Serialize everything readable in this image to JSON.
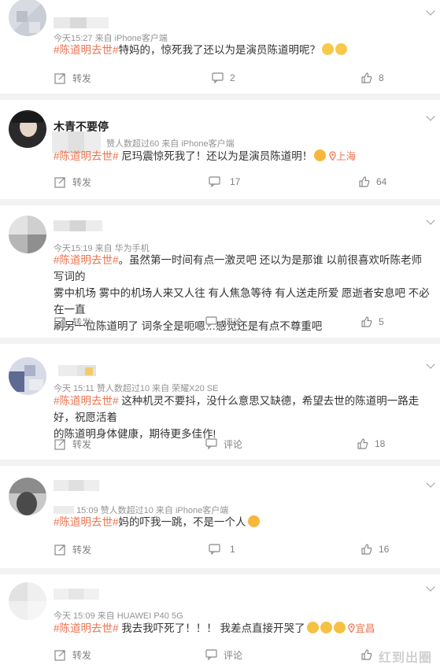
{
  "actions": {
    "repost": "转发",
    "comment": "评论"
  },
  "colors": {
    "accent": "#eb7350",
    "meta": "#939393"
  },
  "posts": [
    {
      "meta": "今天15:27 来自 iPhone客户端",
      "hashtag": "#陈道明去世#",
      "text": "特妈的，惊死我了还以为是演员陈道明呢？",
      "emojis": [
        "wow-emoji",
        "wow-emoji"
      ],
      "comment_count": "2",
      "like_count": "8"
    },
    {
      "username": "木青不要停",
      "meta": "赞人数超过60 来自 iPhone客户端",
      "hashtag": "#陈道明去世#",
      "text": " 尼玛震惊死我了！还以为是演员陈道明！",
      "emojis": [
        "laugh-cry-emoji"
      ],
      "location": "上海",
      "comment_count": "17",
      "like_count": "64"
    },
    {
      "meta": "今天15:19 来自 华为手机",
      "hashtag": "#陈道明去世#",
      "text_lines": [
        "。虽然第一时间有点一激灵吧 还以为是那谁 以前很喜欢听陈老师写词的",
        "雾中机场 雾中的机场人来又人往 有人焦急等待 有人送走所爱 愿逝者安息吧 不必在一直",
        "刷另一位陈道明了 词条全是呃嗯…感觉还是有点不尊重吧"
      ],
      "like_count": "5"
    },
    {
      "meta": "今天 15:11 赞人数超过10  来自 荣耀X20 SE",
      "hashtag": "#陈道明去世#",
      "text_lines": [
        " 这种机灵不要抖，没什么意思又缺德，希望去世的陈道明一路走好，祝愿活着",
        "的陈道明身体健康，期待更多佳作!"
      ],
      "like_count": "18"
    },
    {
      "meta": "15:09 赞人数超过10  来自 iPhone客户端",
      "hashtag": "#陈道明去世#",
      "text": "妈的吓我一跳，不是一个人",
      "emojis": [
        "laugh-emoji"
      ],
      "comment_count": "1",
      "like_count": "16"
    },
    {
      "meta": "今天 15:09 来自 HUAWEI P40 5G",
      "hashtag": "#陈道明去世#",
      "text": " 我去我吓死了！！！ 我差点直接开哭了",
      "emojis": [
        "cry-emoji",
        "cry-emoji",
        "cry-emoji"
      ],
      "location": "宜昌"
    }
  ],
  "watermark": "红到出圈"
}
